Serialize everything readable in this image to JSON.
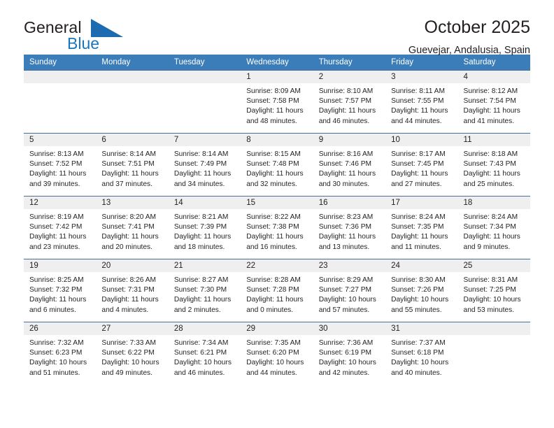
{
  "brand": {
    "name_part1": "General",
    "name_part2": "Blue",
    "logo_icon": "blue-triangle-icon",
    "accent_color": "#1b75bb"
  },
  "header": {
    "title": "October 2025",
    "subtitle": "Guevejar, Andalusia, Spain"
  },
  "calendar": {
    "header_color": "#3b7db9",
    "daynum_band_color": "#efefef",
    "weekday_headers": [
      "Sunday",
      "Monday",
      "Tuesday",
      "Wednesday",
      "Thursday",
      "Friday",
      "Saturday"
    ],
    "labels": {
      "sunrise_prefix": "Sunrise:",
      "sunset_prefix": "Sunset:",
      "daylight_prefix": "Daylight:"
    },
    "weeks": [
      [
        {
          "day": "",
          "sunrise": "",
          "sunset": "",
          "daylight_line1": "",
          "daylight_line2": ""
        },
        {
          "day": "",
          "sunrise": "",
          "sunset": "",
          "daylight_line1": "",
          "daylight_line2": ""
        },
        {
          "day": "",
          "sunrise": "",
          "sunset": "",
          "daylight_line1": "",
          "daylight_line2": ""
        },
        {
          "day": "1",
          "sunrise": "Sunrise: 8:09 AM",
          "sunset": "Sunset: 7:58 PM",
          "daylight_line1": "Daylight: 11 hours",
          "daylight_line2": "and 48 minutes."
        },
        {
          "day": "2",
          "sunrise": "Sunrise: 8:10 AM",
          "sunset": "Sunset: 7:57 PM",
          "daylight_line1": "Daylight: 11 hours",
          "daylight_line2": "and 46 minutes."
        },
        {
          "day": "3",
          "sunrise": "Sunrise: 8:11 AM",
          "sunset": "Sunset: 7:55 PM",
          "daylight_line1": "Daylight: 11 hours",
          "daylight_line2": "and 44 minutes."
        },
        {
          "day": "4",
          "sunrise": "Sunrise: 8:12 AM",
          "sunset": "Sunset: 7:54 PM",
          "daylight_line1": "Daylight: 11 hours",
          "daylight_line2": "and 41 minutes."
        }
      ],
      [
        {
          "day": "5",
          "sunrise": "Sunrise: 8:13 AM",
          "sunset": "Sunset: 7:52 PM",
          "daylight_line1": "Daylight: 11 hours",
          "daylight_line2": "and 39 minutes."
        },
        {
          "day": "6",
          "sunrise": "Sunrise: 8:14 AM",
          "sunset": "Sunset: 7:51 PM",
          "daylight_line1": "Daylight: 11 hours",
          "daylight_line2": "and 37 minutes."
        },
        {
          "day": "7",
          "sunrise": "Sunrise: 8:14 AM",
          "sunset": "Sunset: 7:49 PM",
          "daylight_line1": "Daylight: 11 hours",
          "daylight_line2": "and 34 minutes."
        },
        {
          "day": "8",
          "sunrise": "Sunrise: 8:15 AM",
          "sunset": "Sunset: 7:48 PM",
          "daylight_line1": "Daylight: 11 hours",
          "daylight_line2": "and 32 minutes."
        },
        {
          "day": "9",
          "sunrise": "Sunrise: 8:16 AM",
          "sunset": "Sunset: 7:46 PM",
          "daylight_line1": "Daylight: 11 hours",
          "daylight_line2": "and 30 minutes."
        },
        {
          "day": "10",
          "sunrise": "Sunrise: 8:17 AM",
          "sunset": "Sunset: 7:45 PM",
          "daylight_line1": "Daylight: 11 hours",
          "daylight_line2": "and 27 minutes."
        },
        {
          "day": "11",
          "sunrise": "Sunrise: 8:18 AM",
          "sunset": "Sunset: 7:43 PM",
          "daylight_line1": "Daylight: 11 hours",
          "daylight_line2": "and 25 minutes."
        }
      ],
      [
        {
          "day": "12",
          "sunrise": "Sunrise: 8:19 AM",
          "sunset": "Sunset: 7:42 PM",
          "daylight_line1": "Daylight: 11 hours",
          "daylight_line2": "and 23 minutes."
        },
        {
          "day": "13",
          "sunrise": "Sunrise: 8:20 AM",
          "sunset": "Sunset: 7:41 PM",
          "daylight_line1": "Daylight: 11 hours",
          "daylight_line2": "and 20 minutes."
        },
        {
          "day": "14",
          "sunrise": "Sunrise: 8:21 AM",
          "sunset": "Sunset: 7:39 PM",
          "daylight_line1": "Daylight: 11 hours",
          "daylight_line2": "and 18 minutes."
        },
        {
          "day": "15",
          "sunrise": "Sunrise: 8:22 AM",
          "sunset": "Sunset: 7:38 PM",
          "daylight_line1": "Daylight: 11 hours",
          "daylight_line2": "and 16 minutes."
        },
        {
          "day": "16",
          "sunrise": "Sunrise: 8:23 AM",
          "sunset": "Sunset: 7:36 PM",
          "daylight_line1": "Daylight: 11 hours",
          "daylight_line2": "and 13 minutes."
        },
        {
          "day": "17",
          "sunrise": "Sunrise: 8:24 AM",
          "sunset": "Sunset: 7:35 PM",
          "daylight_line1": "Daylight: 11 hours",
          "daylight_line2": "and 11 minutes."
        },
        {
          "day": "18",
          "sunrise": "Sunrise: 8:24 AM",
          "sunset": "Sunset: 7:34 PM",
          "daylight_line1": "Daylight: 11 hours",
          "daylight_line2": "and 9 minutes."
        }
      ],
      [
        {
          "day": "19",
          "sunrise": "Sunrise: 8:25 AM",
          "sunset": "Sunset: 7:32 PM",
          "daylight_line1": "Daylight: 11 hours",
          "daylight_line2": "and 6 minutes."
        },
        {
          "day": "20",
          "sunrise": "Sunrise: 8:26 AM",
          "sunset": "Sunset: 7:31 PM",
          "daylight_line1": "Daylight: 11 hours",
          "daylight_line2": "and 4 minutes."
        },
        {
          "day": "21",
          "sunrise": "Sunrise: 8:27 AM",
          "sunset": "Sunset: 7:30 PM",
          "daylight_line1": "Daylight: 11 hours",
          "daylight_line2": "and 2 minutes."
        },
        {
          "day": "22",
          "sunrise": "Sunrise: 8:28 AM",
          "sunset": "Sunset: 7:28 PM",
          "daylight_line1": "Daylight: 11 hours",
          "daylight_line2": "and 0 minutes."
        },
        {
          "day": "23",
          "sunrise": "Sunrise: 8:29 AM",
          "sunset": "Sunset: 7:27 PM",
          "daylight_line1": "Daylight: 10 hours",
          "daylight_line2": "and 57 minutes."
        },
        {
          "day": "24",
          "sunrise": "Sunrise: 8:30 AM",
          "sunset": "Sunset: 7:26 PM",
          "daylight_line1": "Daylight: 10 hours",
          "daylight_line2": "and 55 minutes."
        },
        {
          "day": "25",
          "sunrise": "Sunrise: 8:31 AM",
          "sunset": "Sunset: 7:25 PM",
          "daylight_line1": "Daylight: 10 hours",
          "daylight_line2": "and 53 minutes."
        }
      ],
      [
        {
          "day": "26",
          "sunrise": "Sunrise: 7:32 AM",
          "sunset": "Sunset: 6:23 PM",
          "daylight_line1": "Daylight: 10 hours",
          "daylight_line2": "and 51 minutes."
        },
        {
          "day": "27",
          "sunrise": "Sunrise: 7:33 AM",
          "sunset": "Sunset: 6:22 PM",
          "daylight_line1": "Daylight: 10 hours",
          "daylight_line2": "and 49 minutes."
        },
        {
          "day": "28",
          "sunrise": "Sunrise: 7:34 AM",
          "sunset": "Sunset: 6:21 PM",
          "daylight_line1": "Daylight: 10 hours",
          "daylight_line2": "and 46 minutes."
        },
        {
          "day": "29",
          "sunrise": "Sunrise: 7:35 AM",
          "sunset": "Sunset: 6:20 PM",
          "daylight_line1": "Daylight: 10 hours",
          "daylight_line2": "and 44 minutes."
        },
        {
          "day": "30",
          "sunrise": "Sunrise: 7:36 AM",
          "sunset": "Sunset: 6:19 PM",
          "daylight_line1": "Daylight: 10 hours",
          "daylight_line2": "and 42 minutes."
        },
        {
          "day": "31",
          "sunrise": "Sunrise: 7:37 AM",
          "sunset": "Sunset: 6:18 PM",
          "daylight_line1": "Daylight: 10 hours",
          "daylight_line2": "and 40 minutes."
        },
        {
          "day": "",
          "sunrise": "",
          "sunset": "",
          "daylight_line1": "",
          "daylight_line2": ""
        }
      ]
    ]
  }
}
